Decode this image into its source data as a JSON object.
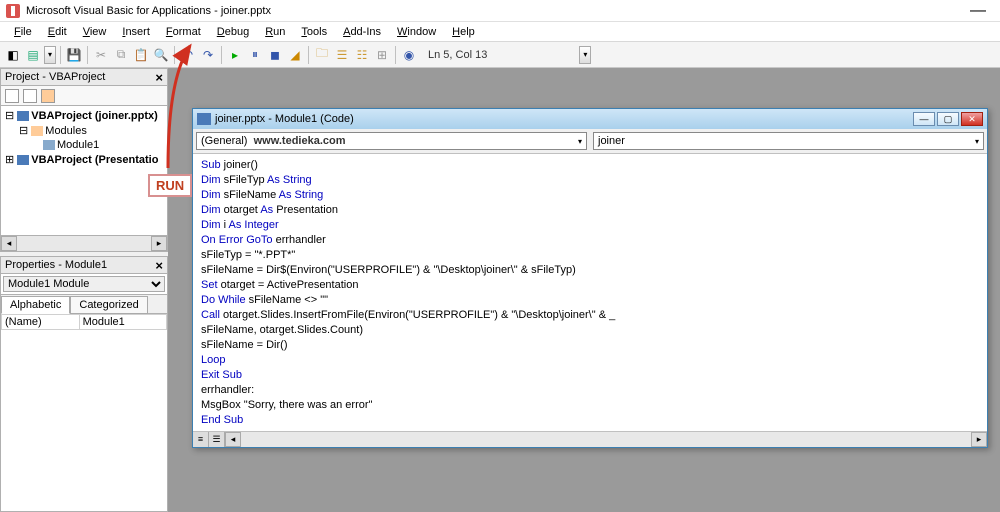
{
  "title": "Microsoft Visual Basic for Applications - joiner.pptx",
  "menu": [
    "File",
    "Edit",
    "View",
    "Insert",
    "Format",
    "Debug",
    "Run",
    "Tools",
    "Add-Ins",
    "Window",
    "Help"
  ],
  "status": "Ln 5, Col 13",
  "project": {
    "title": "Project - VBAProject",
    "items": {
      "p1": "VBAProject (joiner.pptx)",
      "folder": "Modules",
      "mod": "Module1",
      "p2": "VBAProject (Presentatio"
    }
  },
  "props": {
    "title": "Properties - Module1",
    "sel": "Module1 Module",
    "tabs": {
      "a": "Alphabetic",
      "b": "Categorized"
    },
    "row": {
      "k": "(Name)",
      "v": "Module1"
    }
  },
  "codewin": {
    "title": "joiner.pptx - Module1 (Code)",
    "left": "(General)",
    "watermark": "www.tedieka.com",
    "right": "joiner"
  },
  "annot": "RUN",
  "code": {
    "l1a": "Sub",
    "l1b": " joiner()",
    "l2a": "Dim",
    "l2b": " sFileTyp ",
    "l2c": "As String",
    "l3a": "Dim",
    "l3b": " sFileName ",
    "l3c": "As String",
    "l4a": "Dim",
    "l4b": " otarget ",
    "l4c": "As",
    "l4d": " Presentation",
    "l5a": "Dim",
    "l5b": " i ",
    "l5c": "As Integer",
    "l6a": "On Error GoTo",
    "l6b": " errhandler",
    "l7": "sFileTyp = \"*.PPT*\"",
    "l8": "sFileName = Dir$(Environ(\"USERPROFILE\") & \"\\Desktop\\joiner\\\" & sFileTyp)",
    "l9a": "Set",
    "l9b": " otarget = ActivePresentation",
    "l10a": "Do While",
    "l10b": " sFileName <> \"\"",
    "l11a": "Call",
    "l11b": " otarget.Slides.InsertFromFile(Environ(\"USERPROFILE\") & \"\\Desktop\\joiner\\\" & _",
    "l12": "sFileName, otarget.Slides.Count)",
    "l13": "sFileName = Dir()",
    "l14": "Loop",
    "l15": "Exit Sub",
    "l16": "errhandler:",
    "l17": "MsgBox \"Sorry, there was an error\"",
    "l18": "End Sub"
  }
}
